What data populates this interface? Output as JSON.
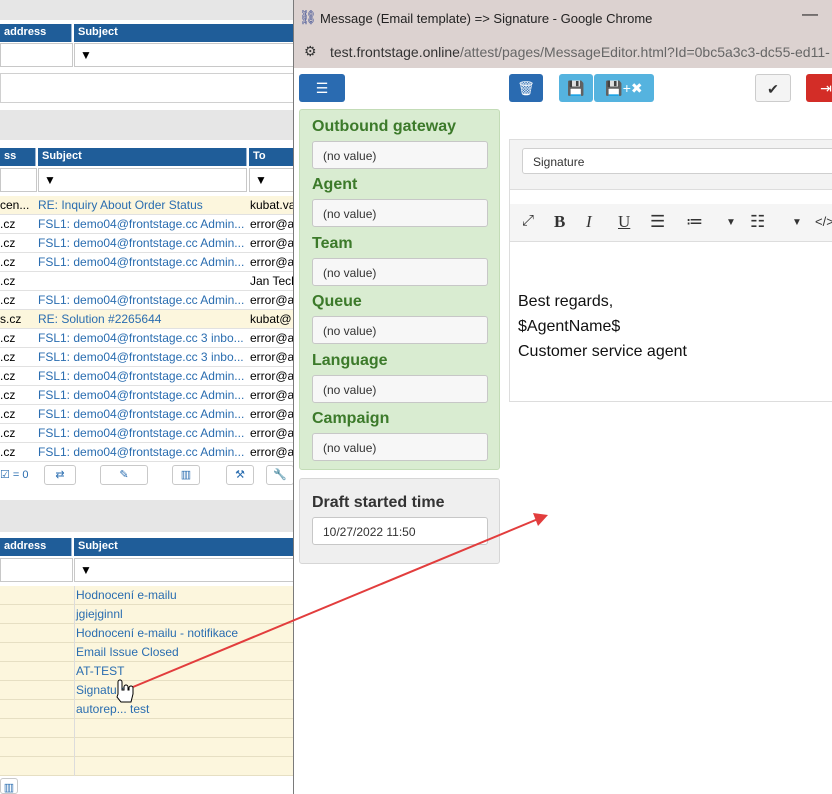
{
  "background_app": {
    "top_grid": {
      "headers": [
        "address",
        "Subject"
      ]
    },
    "mid_grid": {
      "headers": [
        "ss",
        "Subject",
        "To"
      ],
      "rows": [
        {
          "c1": "cen...",
          "subject": "RE: Inquiry About Order Status",
          "to": "kubat.va",
          "highlight": true
        },
        {
          "c1": ".cz",
          "subject": "FSL1: demo04@frontstage.cc Admin...",
          "to": "error@a",
          "highlight": false
        },
        {
          "c1": ".cz",
          "subject": "FSL1: demo04@frontstage.cc Admin...",
          "to": "error@a",
          "highlight": false
        },
        {
          "c1": ".cz",
          "subject": "FSL1: demo04@frontstage.cc Admin...",
          "to": "error@a",
          "highlight": false
        },
        {
          "c1": ".cz",
          "subject": "",
          "to": "Jan Tech",
          "highlight": false
        },
        {
          "c1": ".cz",
          "subject": "FSL1: demo04@frontstage.cc Admin...",
          "to": "error@a",
          "highlight": false
        },
        {
          "c1": "s.cz",
          "subject": "RE: Solution #2265644",
          "to": "kubat@",
          "highlight": true
        },
        {
          "c1": ".cz",
          "subject": "FSL1: demo04@frontstage.cc 3 inbo...",
          "to": "error@a",
          "highlight": false
        },
        {
          "c1": ".cz",
          "subject": "FSL1: demo04@frontstage.cc 3 inbo...",
          "to": "error@a",
          "highlight": false
        },
        {
          "c1": ".cz",
          "subject": "FSL1: demo04@frontstage.cc Admin...",
          "to": "error@a",
          "highlight": false
        },
        {
          "c1": ".cz",
          "subject": "FSL1: demo04@frontstage.cc Admin...",
          "to": "error@a",
          "highlight": false
        },
        {
          "c1": ".cz",
          "subject": "FSL1: demo04@frontstage.cc Admin...",
          "to": "error@a",
          "highlight": false
        },
        {
          "c1": ".cz",
          "subject": "FSL1: demo04@frontstage.cc Admin...",
          "to": "error@a",
          "highlight": false
        },
        {
          "c1": ".cz",
          "subject": "FSL1: demo04@frontstage.cc Admin...",
          "to": "error@a",
          "highlight": false
        }
      ],
      "footer_count": "= 0"
    },
    "bottom_grid": {
      "headers": [
        "address",
        "Subject"
      ],
      "rows": [
        "Hodnocení e-mailu",
        "jgiejginnl",
        "Hodnocení e-mailu - notifikace",
        "Email Issue Closed",
        "AT-TEST",
        "Signature",
        "autorep... test",
        "",
        "",
        ""
      ]
    }
  },
  "window": {
    "title": "Message (Email template) => Signature - Google Chrome",
    "url_host": "test.frontstage.online",
    "url_path": "/attest/pages/MessageEditor.html?Id=0bc5a3c3-dc55-ed11-",
    "title_icon": "chain-link-icon",
    "colors": {
      "primary": "#2a6bb1",
      "info": "#55b3df",
      "danger": "#d32d27",
      "green_label": "#3c7a2a"
    }
  },
  "fields": [
    {
      "label": "Outbound gateway",
      "value": "(no value)"
    },
    {
      "label": "Agent",
      "value": "(no value)"
    },
    {
      "label": "Team",
      "value": "(no value)"
    },
    {
      "label": "Queue",
      "value": "(no value)"
    },
    {
      "label": "Language",
      "value": "(no value)"
    },
    {
      "label": "Campaign",
      "value": "(no value)"
    }
  ],
  "draft": {
    "label": "Draft started time",
    "value": "10/27/2022 11:50"
  },
  "editor": {
    "subject": "Signature",
    "body_lines": [
      "Best regards,",
      "$AgentName$",
      "Customer service agent"
    ],
    "tools": [
      "B",
      "I",
      "U"
    ]
  }
}
